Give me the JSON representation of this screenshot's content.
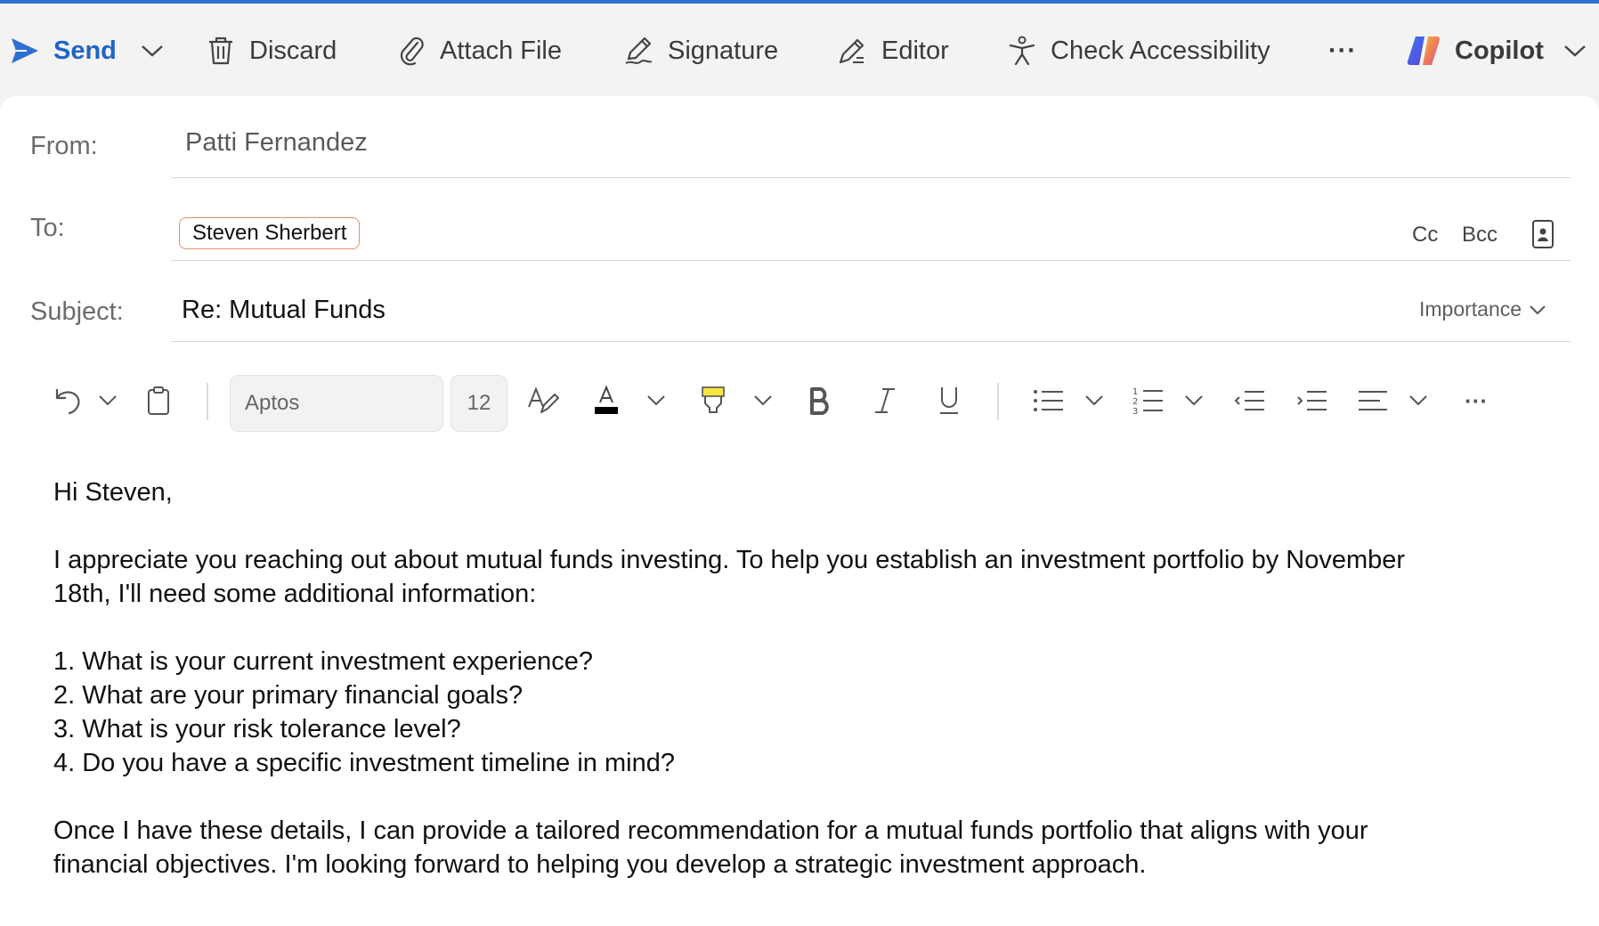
{
  "toolbar": {
    "send_label": "Send",
    "discard_label": "Discard",
    "attach_label": "Attach File",
    "signature_label": "Signature",
    "editor_label": "Editor",
    "accessibility_label": "Check Accessibility",
    "more_label": "···",
    "copilot_label": "Copilot"
  },
  "header": {
    "from_label": "From:",
    "from_value": "Patti Fernandez",
    "to_label": "To:",
    "to_recipient": "Steven Sherbert",
    "cc_label": "Cc",
    "bcc_label": "Bcc",
    "subject_label": "Subject:",
    "subject_value": "Re: Mutual Funds",
    "importance_label": "Importance"
  },
  "format": {
    "font_name": "Aptos",
    "font_size": "12",
    "more_label": "···"
  },
  "body": {
    "greeting": "Hi Steven,",
    "intro_1": "I appreciate you reaching out about mutual funds investing. To help you establish an investment portfolio by November",
    "intro_2": "18th, I'll need some additional information:",
    "q1": "1. What is your current investment experience?",
    "q2": "2. What are your primary financial goals?",
    "q3": "3. What is your risk tolerance level?",
    "q4": "4. Do you have a specific investment timeline in mind?",
    "closing_1": "Once I have these details, I can provide a tailored recommendation for a mutual funds portfolio that aligns with your",
    "closing_2": "financial objectives. I'm looking forward to helping you develop a strategic investment approach."
  },
  "colors": {
    "accent": "#1f64c8",
    "top_border": "#2e6fd1",
    "chip_border": "#e3906a",
    "highlight": "#f5e642"
  }
}
